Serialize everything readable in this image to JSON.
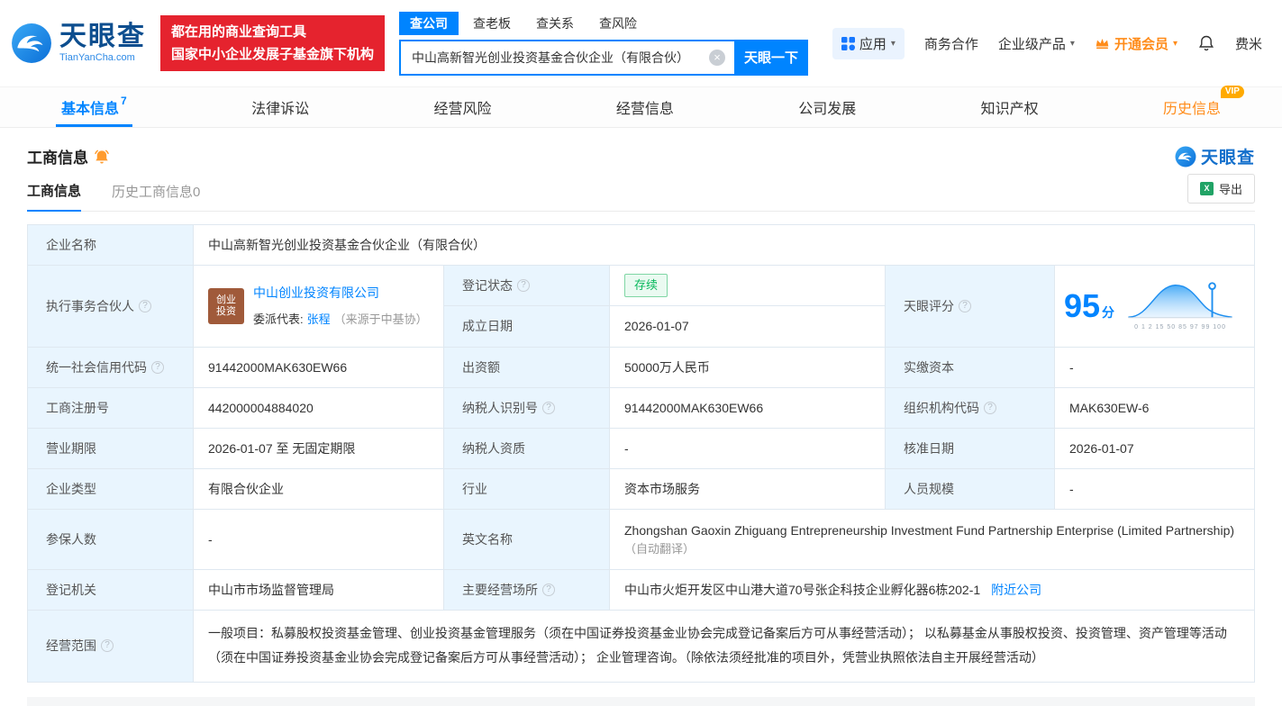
{
  "brand": {
    "name": "天眼查",
    "domain": "TianYanCha.com",
    "blue": "#0084ff"
  },
  "banner": {
    "line1": "都在用的商业查询工具",
    "line2": "国家中小企业发展子基金旗下机构"
  },
  "search": {
    "tabs": [
      {
        "label": "查公司"
      },
      {
        "label": "查老板"
      },
      {
        "label": "查关系"
      },
      {
        "label": "查风险"
      }
    ],
    "value": "中山高新智光创业投资基金合伙企业（有限合伙）",
    "button": "天眼一下"
  },
  "top_menu": {
    "apps": "应用",
    "business": "商务合作",
    "enterprise": "企业级产品",
    "vip": "开通会员",
    "user": "费米"
  },
  "nav": {
    "tabs": [
      {
        "label": "基本信息",
        "badge": "7"
      },
      {
        "label": "法律诉讼"
      },
      {
        "label": "经营风险"
      },
      {
        "label": "经营信息"
      },
      {
        "label": "公司发展"
      },
      {
        "label": "知识产权"
      },
      {
        "label": "历史信息",
        "vip": "VIP"
      }
    ]
  },
  "section": {
    "title": "工商信息",
    "logo": "天眼查",
    "tabs": [
      {
        "label": "工商信息"
      },
      {
        "label": "历史工商信息0"
      }
    ],
    "export": "导出"
  },
  "icons": {
    "help": "?",
    "clear": "×",
    "caret": "▾",
    "excel": "X"
  },
  "info": {
    "labels": {
      "company_name": "企业名称",
      "partner": "执行事务合伙人",
      "reg_status": "登记状态",
      "establish_date": "成立日期",
      "score": "天眼评分",
      "credit_code": "统一社会信用代码",
      "contribution": "出资额",
      "paid_capital": "实缴资本",
      "reg_number": "工商注册号",
      "taxpayer_id": "纳税人识别号",
      "org_code": "组织机构代码",
      "business_term": "营业期限",
      "taxpayer_quality": "纳税人资质",
      "approval_date": "核准日期",
      "company_type": "企业类型",
      "industry": "行业",
      "staff_size": "人员规模",
      "insured_count": "参保人数",
      "english_name": "英文名称",
      "reg_authority": "登记机关",
      "business_site": "主要经营场所",
      "business_scope": "经营范围"
    },
    "values": {
      "company_name": "中山高新智光创业投资基金合伙企业（有限合伙）",
      "partner_logo_line1": "创业",
      "partner_logo_line2": "投资",
      "partner_company": "中山创业投资有限公司",
      "delegate_prefix": "委派代表:",
      "delegate_name": "张程",
      "delegate_source": "（来源于中基协）",
      "reg_status": "存续",
      "establish_date": "2026-01-07",
      "score_value": "95",
      "score_unit": "分",
      "score_axis": "0 1 2 15 50 85 97 99 100",
      "credit_code": "91442000MAK630EW66",
      "contribution": "50000万人民币",
      "paid_capital": "-",
      "reg_number": "442000004884020",
      "taxpayer_id": "91442000MAK630EW66",
      "org_code": "MAK630EW-6",
      "business_term": "2026-01-07 至 无固定期限",
      "taxpayer_quality": "-",
      "approval_date": "2026-01-07",
      "company_type": "有限合伙企业",
      "industry": "资本市场服务",
      "staff_size": "-",
      "insured_count": "-",
      "english_name": "Zhongshan Gaoxin Zhiguang Entrepreneurship Investment Fund Partnership Enterprise (Limited Partnership)",
      "english_name_note": "（自动翻译）",
      "reg_authority": "中山市市场监督管理局",
      "business_site": "中山市火炬开发区中山港大道70号张企科技企业孵化器6栋202-1",
      "nearby_link": "附近公司",
      "business_scope": "一般项目：私募股权投资基金管理、创业投资基金管理服务（须在中国证券投资基金业协会完成登记备案后方可从事经营活动）； 以私募基金从事股权投资、投资管理、资产管理等活动（须在中国证券投资基金业协会完成登记备案后方可从事经营活动）； 企业管理咨询。（除依法须经批准的项目外，凭营业执照依法自主开展经营活动）"
    }
  }
}
